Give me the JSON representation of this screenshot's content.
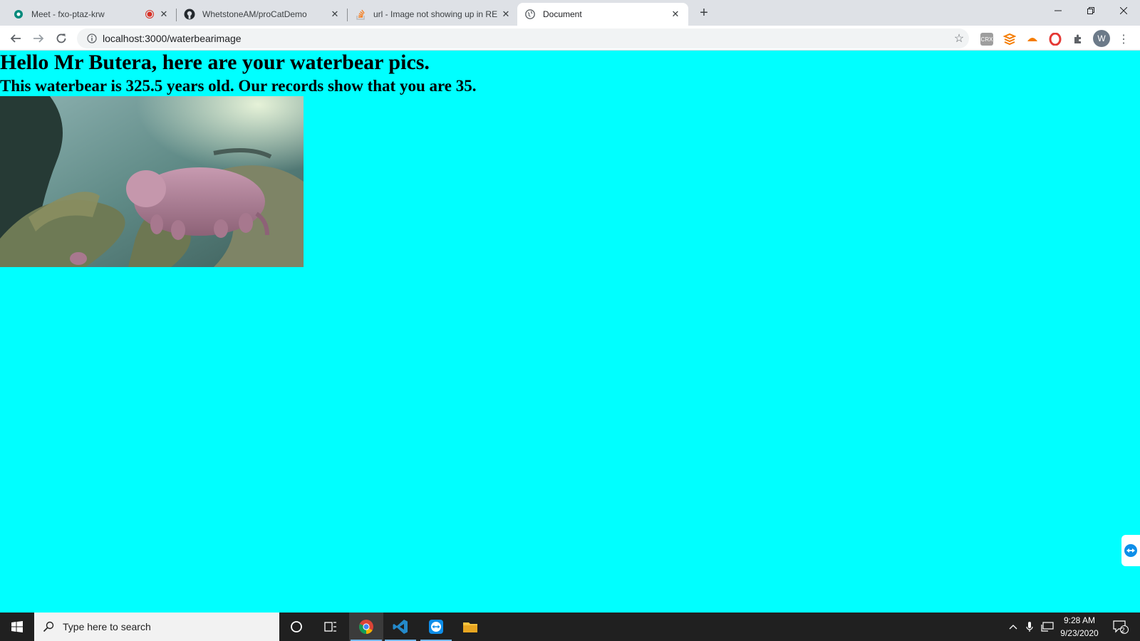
{
  "browser": {
    "tabs": [
      {
        "title": "Meet - fxo-ptaz-krw",
        "icon": "meet-icon",
        "recording": true
      },
      {
        "title": "WhetstoneAM/proCatDemo",
        "icon": "github-icon"
      },
      {
        "title": "url - Image not showing up in RE",
        "icon": "stackoverflow-icon"
      },
      {
        "title": "Document",
        "icon": "globe-icon",
        "active": true
      }
    ],
    "new_tab_label": "+",
    "url": "localhost:3000/waterbearimage",
    "profile_initial": "W",
    "extensions": [
      "crx-icon",
      "layers-extension-icon",
      "orange-extension-icon",
      "opera-extension-icon",
      "puzzle-icon"
    ]
  },
  "page": {
    "heading": "Hello Mr Butera, here are your waterbear pics.",
    "subheading": "This waterbear is 325.5 years old. Our records show that you are 35.",
    "image_alt": "tardigrade-photo",
    "background_color": "#00ffff"
  },
  "taskbar": {
    "search_placeholder": "Type here to search",
    "pinned": [
      "cortana-icon",
      "task-view-icon",
      "chrome-icon",
      "vscode-icon",
      "teamviewer-icon",
      "file-explorer-icon"
    ],
    "time": "9:28 AM",
    "date": "9/23/2020",
    "notifications_count": "2"
  }
}
